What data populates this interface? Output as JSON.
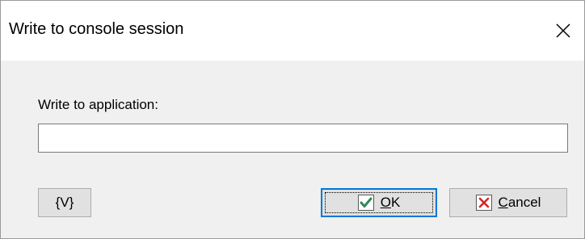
{
  "window": {
    "title": "Write to console session",
    "close_icon": "close-icon"
  },
  "form": {
    "field_label": "Write to application:",
    "field_value": "",
    "field_placeholder": ""
  },
  "buttons": {
    "variables_label": "{V}",
    "ok_label_underlined": "O",
    "ok_label_rest": "K",
    "ok_icon": "check-icon",
    "cancel_label_underlined": "C",
    "cancel_label_rest": "ancel",
    "cancel_icon": "cancel-x-icon"
  },
  "colors": {
    "check_green": "#2e8b57",
    "cancel_red": "#d62828",
    "focus_blue": "#0078d7"
  }
}
